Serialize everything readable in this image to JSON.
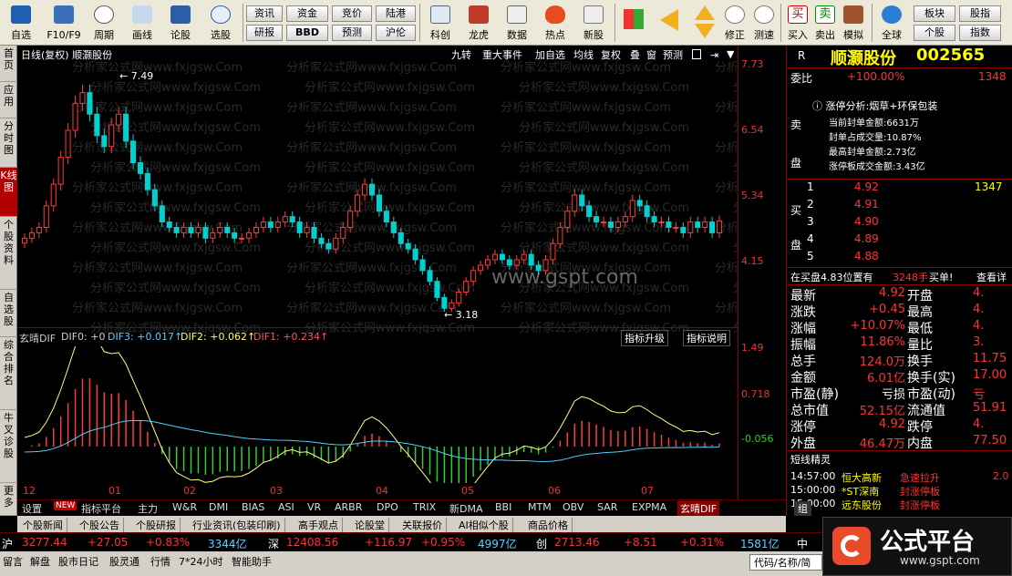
{
  "toolbar": {
    "items": [
      {
        "label": "自选",
        "icon": "star-icon"
      },
      {
        "label": "F10/F9",
        "icon": "f10-icon"
      },
      {
        "label": "周期",
        "icon": "clock-icon"
      },
      {
        "label": "画线",
        "icon": "pen-icon"
      },
      {
        "label": "论股",
        "icon": "chat-icon"
      },
      {
        "label": "选股",
        "icon": "pick-icon"
      }
    ],
    "buttons": [
      {
        "label": "资讯"
      },
      {
        "label": "资金"
      },
      {
        "label": "竞价"
      },
      {
        "label": "陆港"
      },
      {
        "label": "研报"
      },
      {
        "label": "BBD"
      },
      {
        "label": "预测"
      },
      {
        "label": "沪伦"
      }
    ],
    "items2": [
      {
        "label": "科创",
        "icon": "chart-icon"
      },
      {
        "label": "龙虎",
        "icon": "dragon-icon"
      },
      {
        "label": "数据",
        "icon": "pe-icon"
      },
      {
        "label": "热点",
        "icon": "fire-icon"
      },
      {
        "label": "新股",
        "icon": "ipo-icon"
      }
    ],
    "items3": [
      {
        "label": "修正",
        "icon": "up-down-icon"
      },
      {
        "label": "测速",
        "icon": "timer-icon"
      },
      {
        "label": "买入",
        "icon": "buy-icon"
      },
      {
        "label": "卖出",
        "icon": "sell-icon"
      },
      {
        "label": "模拟",
        "icon": "hammer-icon"
      },
      {
        "label": "全球",
        "icon": "globe-icon"
      }
    ],
    "buttons2": [
      {
        "label": "板块"
      },
      {
        "label": "股指"
      },
      {
        "label": "个股"
      },
      {
        "label": "指数"
      }
    ]
  },
  "leftnav": [
    "首页",
    "应用",
    "分时图",
    "K线图",
    "个股资料",
    "自选股",
    "综合排名",
    "牛叉诊股",
    "更多"
  ],
  "chart": {
    "title": "日线(复权)  顺灏股份",
    "menu": [
      "九转",
      "重大事件",
      "加自选",
      "均线",
      "复权",
      "叠",
      "窗",
      "预测"
    ],
    "price_ticks": [
      "7.73",
      "6.54",
      "5.34",
      "4.15"
    ],
    "high_label": "7.49",
    "low_label": "3.18",
    "watermark": "www.gspt.com",
    "bg_watermark": "分析家公式网www.fxjgsw.Com",
    "month_labels": [
      "12",
      "01",
      "02",
      "03",
      "04",
      "05",
      "06",
      "07"
    ],
    "indicator_legend": {
      "name": "玄晴DIF",
      "dif0": "DIF0: +0",
      "dif3": "DIF3: +0.017↑",
      "dif2": "DIF2: +0.062↑",
      "dif1": "DIF1: +0.234↑"
    },
    "indicator_buttons": [
      "指标升级",
      "指标说明"
    ],
    "indicator_ticks": [
      "1.49",
      "0.718",
      "-0.056"
    ]
  },
  "chart_data": {
    "type": "candlestick",
    "title": "日线(复权) 顺灏股份",
    "x_labels": [
      "12",
      "01",
      "02",
      "03",
      "04",
      "05",
      "06",
      "07"
    ],
    "ylim": [
      3.0,
      7.8
    ],
    "high": 7.49,
    "low": 3.18,
    "last": 4.92,
    "closes": [
      4.6,
      4.7,
      4.8,
      5.2,
      5.6,
      6.1,
      6.6,
      7.1,
      7.3,
      6.9,
      6.5,
      6.3,
      6.7,
      6.9,
      6.4,
      6.0,
      5.8,
      5.5,
      5.2,
      4.9,
      4.8,
      4.7,
      4.8,
      4.7,
      4.8,
      4.6,
      4.7,
      4.8,
      4.7,
      4.6,
      4.6,
      4.7,
      4.8,
      4.9,
      4.8,
      4.9,
      5.0,
      4.9,
      4.7,
      4.8,
      4.6,
      4.5,
      4.4,
      4.6,
      4.8,
      5.1,
      5.4,
      5.6,
      5.4,
      5.1,
      4.9,
      4.7,
      4.5,
      4.4,
      4.2,
      4.0,
      3.8,
      3.5,
      3.3,
      3.4,
      3.6,
      3.8,
      4.0,
      4.1,
      4.2,
      4.3,
      4.2,
      4.1,
      4.2,
      4.3,
      4.1,
      4.0,
      4.2,
      4.5,
      4.8,
      5.1,
      5.4,
      5.2,
      5.0,
      4.9,
      4.9,
      4.8,
      4.9,
      5.0,
      5.3,
      5.2,
      5.0,
      4.9,
      4.9,
      4.8,
      4.8,
      4.7,
      4.9,
      4.8,
      4.9,
      4.7,
      4.92
    ]
  },
  "tabs": [
    "设置",
    "NEW",
    "指标平台",
    "主力",
    "W&R",
    "DMI",
    "BIAS",
    "ASI",
    "VR",
    "ARBR",
    "DPO",
    "TRIX",
    "新DMA",
    "BBI",
    "MTM",
    "OBV",
    "SAR",
    "EXPMA",
    "玄晴DIF"
  ],
  "newstabs": [
    "个股新闻",
    "个股公告",
    "个股研报",
    "行业资讯(包装印刷)",
    "高手观点",
    "论股堂",
    "关联报价",
    "AI相似个股",
    "商品价格"
  ],
  "right": {
    "name": "顺灏股份",
    "code": "002565",
    "webi_label": "委比",
    "webi_value": "+100.00%",
    "webi_num": "1348",
    "sell_label": "卖盘",
    "buy_label": "买盘",
    "limit_title": "涨停分析:烟草+环保包装",
    "limit_lines": [
      "当前封单金额:6631万",
      "封单占成交量:10.87%",
      "最高封单金额:2.73亿",
      "涨停板成交金额:3.43亿"
    ],
    "buy_levels": [
      {
        "n": "1",
        "p": "4.92",
        "v": "1347"
      },
      {
        "n": "2",
        "p": "4.91",
        "v": ""
      },
      {
        "n": "3",
        "p": "4.90",
        "v": ""
      },
      {
        "n": "4",
        "p": "4.89",
        "v": ""
      },
      {
        "n": "5",
        "p": "4.88",
        "v": ""
      }
    ],
    "position_text": "在买盘4.83位置有",
    "position_vol": "3248手",
    "position_act": "买单!",
    "position_link": "查看详",
    "stats": [
      {
        "l": "最新",
        "v": "4.92",
        "l2": "开盘",
        "v2": "4."
      },
      {
        "l": "涨跌",
        "v": "+0.45",
        "l2": "最高",
        "v2": "4."
      },
      {
        "l": "涨幅",
        "v": "+10.07%",
        "l2": "最低",
        "v2": "4."
      },
      {
        "l": "振幅",
        "v": "11.86%",
        "l2": "量比",
        "v2": "3."
      },
      {
        "l": "总手",
        "v": "124.0万",
        "l2": "换手",
        "v2": "11.75"
      },
      {
        "l": "金额",
        "v": "6.01亿",
        "l2": "换手(实)",
        "v2": "17.00"
      },
      {
        "l": "市盈(静)",
        "v": "亏损",
        "l2": "市盈(动)",
        "v2": "亏"
      },
      {
        "l": "总市值",
        "v": "52.15亿",
        "l2": "流通值",
        "v2": "51.91"
      },
      {
        "l": "涨停",
        "v": "4.92",
        "l2": "跌停",
        "v2": "4."
      },
      {
        "l": "外盘",
        "v": "46.47万",
        "l2": "内盘",
        "v2": "77.50"
      }
    ],
    "short_title": "短线精灵",
    "short_rows": [
      {
        "t": "14:57:00",
        "s": "恒大高新",
        "e": "急速拉升",
        "v": "2.0"
      },
      {
        "t": "15:00:00",
        "s": "*ST深南",
        "e": "封涨停板",
        "v": ""
      },
      {
        "t": "15:00:00",
        "s": "远东股份",
        "e": "封涨停板",
        "v": ""
      }
    ],
    "short_tabs": [
      "组"
    ]
  },
  "indexbar": [
    {
      "k": "沪",
      "v": "3277.44",
      "c": "+27.05",
      "p": "+0.83%",
      "a": "3344亿"
    },
    {
      "k": "深",
      "v": "12408.56",
      "c": "+116.97",
      "p": "+0.95%",
      "a": "4997亿"
    },
    {
      "k": "创",
      "v": "2713.46",
      "c": "+8.51",
      "p": "+0.31%",
      "a": "1581亿"
    },
    {
      "k": "中",
      "v": "",
      "c": "",
      "p": "",
      "a": ""
    }
  ],
  "bottombar": [
    "留言",
    "解盘",
    "股市日记",
    "股灵通",
    "行情",
    "7*24小时",
    "智能助手"
  ],
  "bottom_search": "代码/名称/简",
  "logo": {
    "title": "公式平台",
    "url": "www.gspt.com"
  }
}
